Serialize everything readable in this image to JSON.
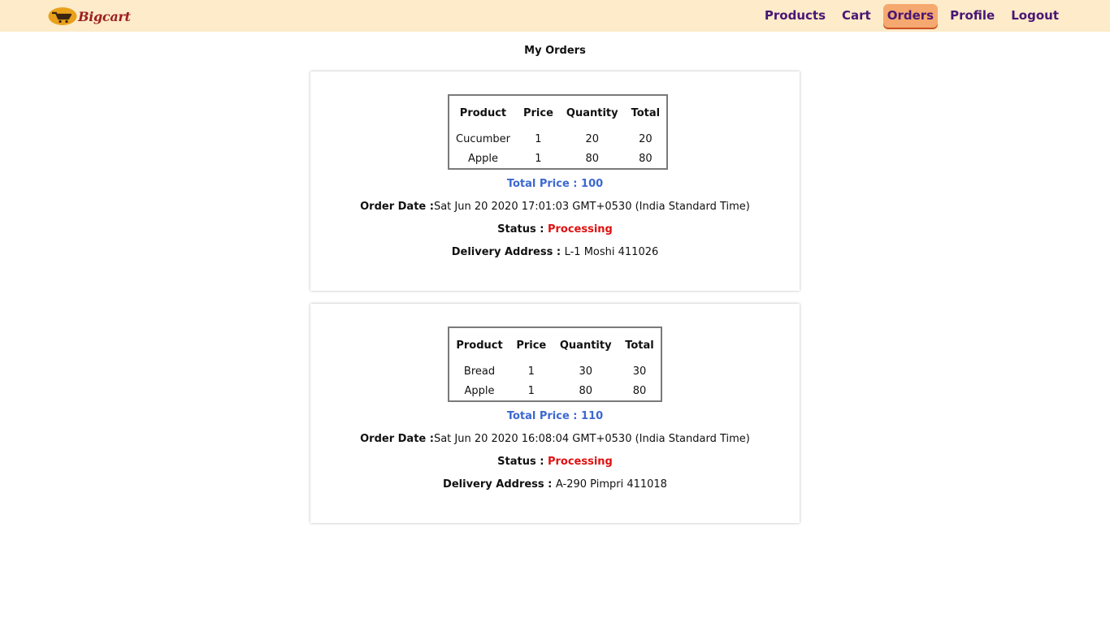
{
  "brand": {
    "name": "Bigcart",
    "logo_icon": "cart-logo-icon"
  },
  "nav": [
    {
      "label": "Products",
      "active": false
    },
    {
      "label": "Cart",
      "active": false
    },
    {
      "label": "Orders",
      "active": true
    },
    {
      "label": "Profile",
      "active": false
    },
    {
      "label": "Logout",
      "active": false
    }
  ],
  "page_title": "My Orders",
  "table_headers": [
    "Product",
    "Price",
    "Quantity",
    "Total"
  ],
  "labels": {
    "total_price": "Total Price : ",
    "order_date": "Order Date :",
    "status": "Status : ",
    "delivery_address": "Delivery Address : "
  },
  "orders": [
    {
      "items": [
        {
          "product": "Cucumber",
          "price": "1",
          "quantity": "20",
          "total": "20"
        },
        {
          "product": "Apple",
          "price": "1",
          "quantity": "80",
          "total": "80"
        }
      ],
      "total_price": "100",
      "order_date": "Sat Jun 20 2020 17:01:03 GMT+0530 (India Standard Time)",
      "status": "Processing",
      "delivery_address": "L-1 Moshi 411026"
    },
    {
      "items": [
        {
          "product": "Bread",
          "price": "1",
          "quantity": "30",
          "total": "30"
        },
        {
          "product": "Apple",
          "price": "1",
          "quantity": "80",
          "total": "80"
        }
      ],
      "total_price": "110",
      "order_date": "Sat Jun 20 2020 16:08:04 GMT+0530 (India Standard Time)",
      "status": "Processing",
      "delivery_address": "A-290 Pimpri 411018"
    }
  ],
  "colors": {
    "navbar_bg": "#fdebc9",
    "nav_text": "#4a1675",
    "nav_active_bg": "#f5a86f",
    "brand_text": "#9c2020",
    "total_price": "#3c68d0",
    "status": "#e01010"
  }
}
